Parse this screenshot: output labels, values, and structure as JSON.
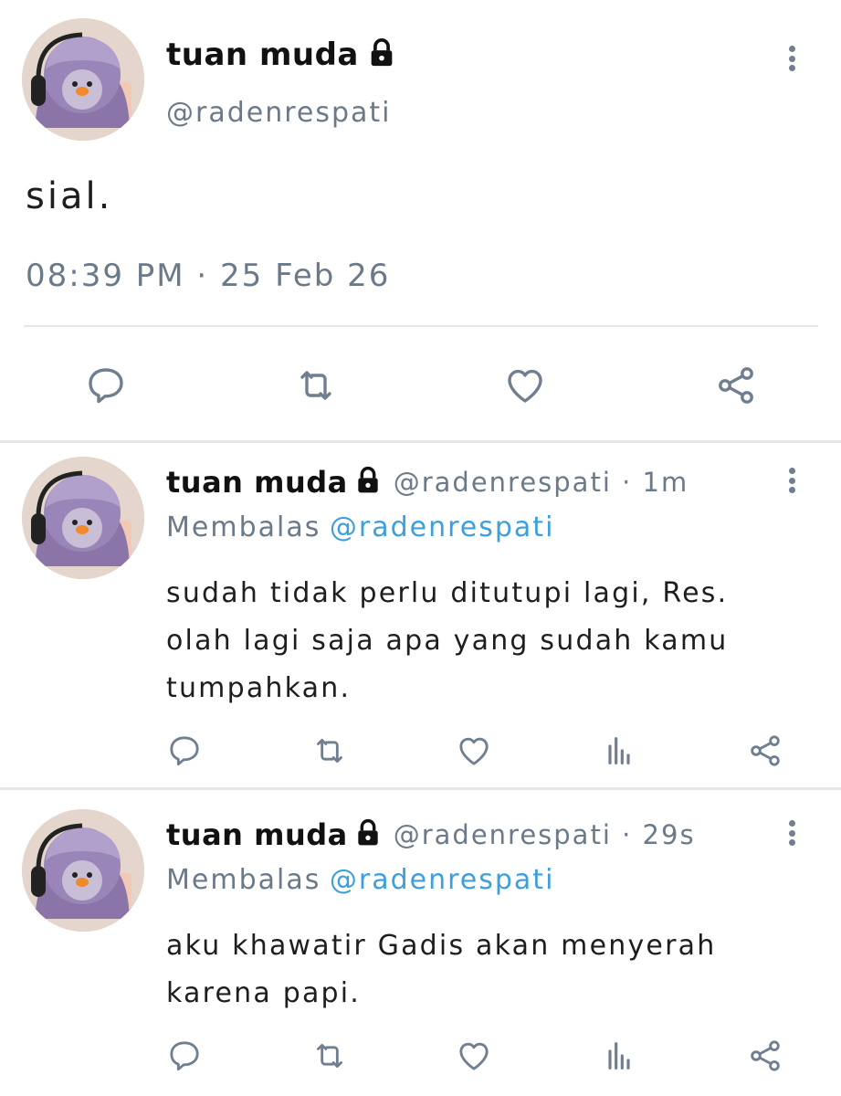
{
  "main_tweet": {
    "display_name": "tuan muda",
    "handle": "@radenrespati",
    "text": "sial.",
    "timestamp": "08:39 PM · 25 Feb 26"
  },
  "replies": [
    {
      "display_name": "tuan muda",
      "handle_time": "@radenrespati · 1m",
      "replying_label": "Membalas",
      "replying_to": "@radenrespati",
      "lines": [
        "sudah tidak perlu ditutupi lagi, Res.",
        "olah lagi saja apa yang sudah kamu",
        "tumpahkan."
      ]
    },
    {
      "display_name": "tuan muda",
      "handle_time": "@radenrespati · 29s",
      "replying_label": "Membalas",
      "replying_to": "@radenrespati",
      "lines": [
        "aku khawatir Gadis akan menyerah",
        "karena papi."
      ]
    }
  ],
  "icons": {
    "reply": "speech-bubble-icon",
    "retweet": "retweet-icon",
    "like": "heart-icon",
    "views": "bar-chart-icon",
    "share": "share-icon",
    "more": "kebab-menu-icon",
    "protected": "lock-icon"
  },
  "colors": {
    "icon_gray": "#6f7f8f",
    "link_blue": "#3e9fdc",
    "muted_text": "#6b7a89",
    "divider": "#e3e6ea"
  }
}
